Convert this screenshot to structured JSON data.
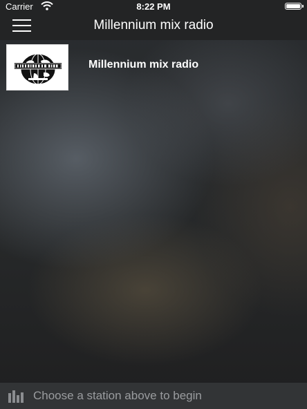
{
  "status_bar": {
    "carrier": "Carrier",
    "time": "8:22 PM",
    "wifi_icon": "wifi-icon",
    "battery_icon": "battery-icon"
  },
  "nav": {
    "title": "Millennium mix radio",
    "menu_icon": "hamburger-menu-icon"
  },
  "stations": [
    {
      "name": "Millennium mix radio",
      "logo": "millennium-mix-globe-logo"
    }
  ],
  "footer": {
    "icon": "equalizer-icon",
    "prompt": "Choose a station above to begin"
  },
  "colors": {
    "bar_background": "#232425",
    "footer_background": "#323436",
    "footer_text": "#9a9c9f"
  }
}
